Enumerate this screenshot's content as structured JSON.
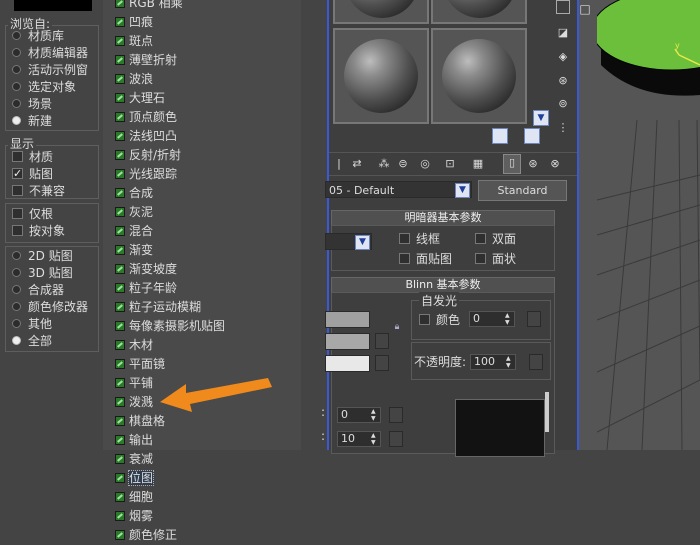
{
  "left": {
    "browse_title": "浏览自:",
    "browse_options": [
      {
        "label": "材质库",
        "selected": false
      },
      {
        "label": "材质编辑器",
        "selected": false
      },
      {
        "label": "活动示例窗",
        "selected": false
      },
      {
        "label": "选定对象",
        "selected": false
      },
      {
        "label": "场景",
        "selected": false
      },
      {
        "label": "新建",
        "selected": true
      }
    ],
    "show_title": "显示",
    "show_options": [
      {
        "label": "材质",
        "checked": false
      },
      {
        "label": "贴图",
        "checked": true
      },
      {
        "label": "不兼容",
        "checked": false
      }
    ],
    "filter_options": [
      {
        "label": "仅根",
        "checked": false
      },
      {
        "label": "按对象",
        "checked": false
      }
    ],
    "type_options": [
      {
        "label": "2D 贴图",
        "selected": false
      },
      {
        "label": "3D 贴图",
        "selected": false
      },
      {
        "label": "合成器",
        "selected": false
      },
      {
        "label": "颜色修改器",
        "selected": false
      },
      {
        "label": "其他",
        "selected": false
      },
      {
        "label": "全部",
        "selected": true
      }
    ]
  },
  "map_list": {
    "items": [
      "RGB 相乘",
      "凹痕",
      "斑点",
      "薄壁折射",
      "波浪",
      "大理石",
      "顶点颜色",
      "法线凹凸",
      "反射/折射",
      "光线跟踪",
      "合成",
      "灰泥",
      "混合",
      "渐变",
      "渐变坡度",
      "粒子年龄",
      "粒子运动模糊",
      "每像素摄影机贴图",
      "木材",
      "平面镜",
      "平铺",
      "泼溅",
      "棋盘格",
      "输出",
      "衰减",
      "位图",
      "细胞",
      "烟雾",
      "颜色修正"
    ],
    "selected_index": 25
  },
  "material_editor": {
    "material_name": "05 - Default",
    "shader_type_button": "Standard",
    "shader_rollout_title": "明暗器基本参数",
    "shader_checks": [
      {
        "label": "线框",
        "checked": false
      },
      {
        "label": "双面",
        "checked": false
      },
      {
        "label": "面贴图",
        "checked": false
      },
      {
        "label": "面状",
        "checked": false
      }
    ],
    "blinn_rollout_title": "Blinn 基本参数",
    "self_illum_title": "自发光",
    "color_label": "颜色",
    "color_value": "0",
    "opacity_label": "不透明度:",
    "opacity_value": "100",
    "spec_level_value": "0",
    "glossiness_value": "10",
    "colors": {
      "accent_border": "#3a59d6",
      "arrow": "#f08a1c",
      "ground": "#6bbf3a"
    }
  },
  "viewport": {
    "axis_label": "y",
    "object_color": "#6bbf3a"
  }
}
